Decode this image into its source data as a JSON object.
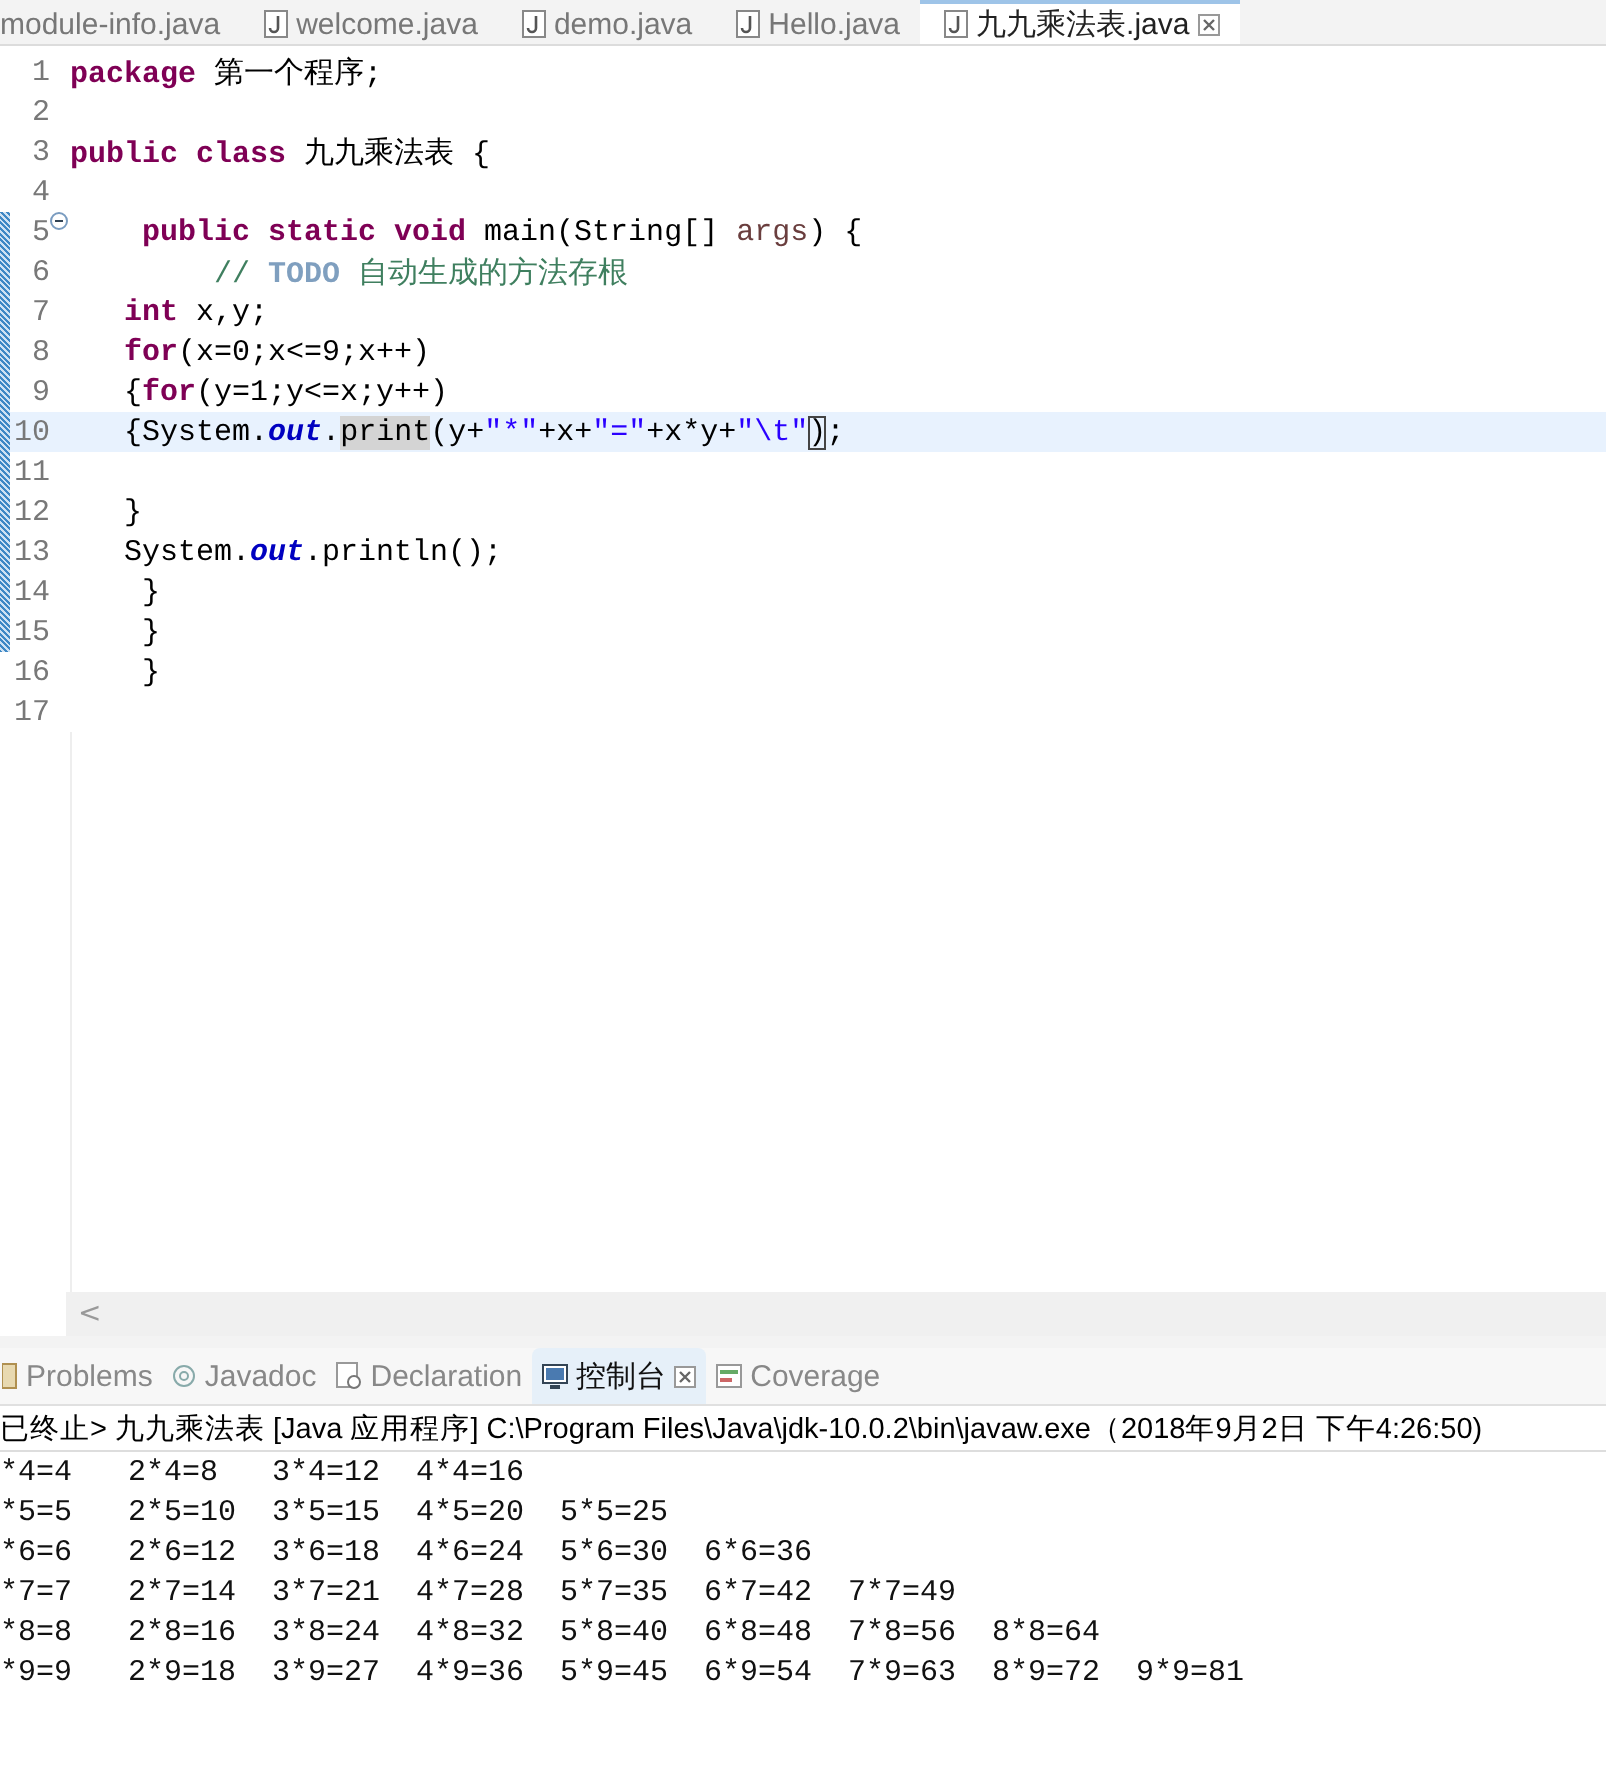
{
  "editor_tabs": [
    {
      "label": "module-info.java",
      "selected": false,
      "closable": false
    },
    {
      "label": "welcome.java",
      "selected": false,
      "closable": false
    },
    {
      "label": "demo.java",
      "selected": false,
      "closable": false
    },
    {
      "label": "Hello.java",
      "selected": false,
      "closable": false
    },
    {
      "label": "九九乘法表.java",
      "selected": true,
      "closable": true
    }
  ],
  "code_lines": [
    {
      "number": "1",
      "changed": false,
      "fold": false,
      "current": false,
      "tokens": [
        {
          "kind": "keyword",
          "text": "package"
        },
        {
          "kind": "plain",
          "text": " 第一个程序;"
        }
      ]
    },
    {
      "number": "2",
      "changed": false,
      "fold": false,
      "current": false
    },
    {
      "number": "3",
      "changed": false,
      "fold": false,
      "current": false,
      "tokens": [
        {
          "kind": "keyword",
          "text": "public class"
        },
        {
          "kind": "plain",
          "text": " 九九乘法表 {"
        }
      ]
    },
    {
      "number": "4",
      "changed": false,
      "fold": false,
      "current": false
    },
    {
      "number": "5",
      "changed": true,
      "fold": true,
      "current": false,
      "tokens": [
        {
          "kind": "keyword",
          "text": "    public static void"
        },
        {
          "kind": "plain",
          "text": " main(String[] "
        },
        {
          "kind": "param",
          "text": "args"
        },
        {
          "kind": "plain",
          "text": ") {"
        }
      ]
    },
    {
      "number": "6",
      "changed": true,
      "fold": false,
      "current": false,
      "tokens": [
        {
          "kind": "comment",
          "text": "        //"
        },
        {
          "kind": "todo",
          "text": " TODO"
        },
        {
          "kind": "comment",
          "text": " 自动生成的方法存根"
        }
      ]
    },
    {
      "number": "7",
      "changed": true,
      "fold": false,
      "current": false,
      "tokens": [
        {
          "kind": "keyword",
          "text": "   int"
        },
        {
          "kind": "plain",
          "text": " x,y;"
        }
      ]
    },
    {
      "number": "8",
      "changed": true,
      "fold": false,
      "current": false,
      "tokens": [
        {
          "kind": "keyword",
          "text": "   for"
        },
        {
          "kind": "plain",
          "text": "(x=0;x<=9;x++)"
        }
      ]
    },
    {
      "number": "9",
      "changed": true,
      "fold": false,
      "current": false,
      "tokens": [
        {
          "kind": "plain",
          "text": "   {"
        },
        {
          "kind": "keyword",
          "text": "for"
        },
        {
          "kind": "plain",
          "text": "(y=1;y<=x;y++)"
        }
      ]
    },
    {
      "number": "10",
      "changed": true,
      "fold": false,
      "current": true,
      "tokens": [
        {
          "kind": "plain",
          "text": "   {System."
        },
        {
          "kind": "field",
          "text": "out"
        },
        {
          "kind": "plain",
          "text": "."
        },
        {
          "kind": "occurrence",
          "text": "print"
        },
        {
          "kind": "plain",
          "text": "(y+"
        },
        {
          "kind": "string",
          "text": "\"*\""
        },
        {
          "kind": "plain",
          "text": "+x+"
        },
        {
          "kind": "string",
          "text": "\"=\""
        },
        {
          "kind": "plain",
          "text": "+x*y+"
        },
        {
          "kind": "string",
          "text": "\"\\t\""
        },
        {
          "kind": "bracket",
          "text": ")"
        },
        {
          "kind": "plain",
          "text": ";"
        }
      ]
    },
    {
      "number": "11",
      "changed": true,
      "fold": false,
      "current": false
    },
    {
      "number": "12",
      "changed": true,
      "fold": false,
      "current": false,
      "tokens": [
        {
          "kind": "plain",
          "text": "   }"
        }
      ]
    },
    {
      "number": "13",
      "changed": true,
      "fold": false,
      "current": false,
      "tokens": [
        {
          "kind": "plain",
          "text": "   System."
        },
        {
          "kind": "field",
          "text": "out"
        },
        {
          "kind": "plain",
          "text": ".println();"
        }
      ]
    },
    {
      "number": "14",
      "changed": true,
      "fold": false,
      "current": false,
      "tokens": [
        {
          "kind": "plain",
          "text": "    }"
        }
      ]
    },
    {
      "number": "15",
      "changed": true,
      "fold": false,
      "current": false,
      "tokens": [
        {
          "kind": "plain",
          "text": "    }"
        }
      ]
    },
    {
      "number": "16",
      "changed": false,
      "fold": false,
      "current": false,
      "tokens": [
        {
          "kind": "plain",
          "text": "    }"
        }
      ]
    },
    {
      "number": "17",
      "changed": false,
      "fold": false,
      "current": false
    }
  ],
  "scroll_left_glyph": "<",
  "panel_tabs": [
    {
      "label": "Problems",
      "kind": "problems",
      "selected": false
    },
    {
      "label": "Javadoc",
      "kind": "javadoc",
      "selected": false
    },
    {
      "label": "Declaration",
      "kind": "declaration",
      "selected": false
    },
    {
      "label": "控制台",
      "kind": "console",
      "selected": true
    },
    {
      "label": "Coverage",
      "kind": "coverage",
      "selected": false
    }
  ],
  "console_header": "已终止> 九九乘法表 [Java 应用程序] C:\\Program Files\\Java\\jdk-10.0.2\\bin\\javaw.exe（2018年9月2日 下午4:26:50)",
  "console_rows": [
    [
      "*4=4",
      "2*4=8",
      "3*4=12",
      "4*4=16"
    ],
    [
      "*5=5",
      "2*5=10",
      "3*5=15",
      "4*5=20",
      "5*5=25"
    ],
    [
      "*6=6",
      "2*6=12",
      "3*6=18",
      "4*6=24",
      "5*6=30",
      "6*6=36"
    ],
    [
      "*7=7",
      "2*7=14",
      "3*7=21",
      "4*7=28",
      "5*7=35",
      "6*7=42",
      "7*7=49"
    ],
    [
      "*8=8",
      "2*8=16",
      "3*8=24",
      "4*8=32",
      "5*8=40",
      "6*8=48",
      "7*8=56",
      "8*8=64"
    ],
    [
      "*9=9",
      "2*9=18",
      "3*9=27",
      "4*9=36",
      "5*9=45",
      "6*9=54",
      "7*9=63",
      "8*9=72",
      "9*9=81"
    ]
  ]
}
